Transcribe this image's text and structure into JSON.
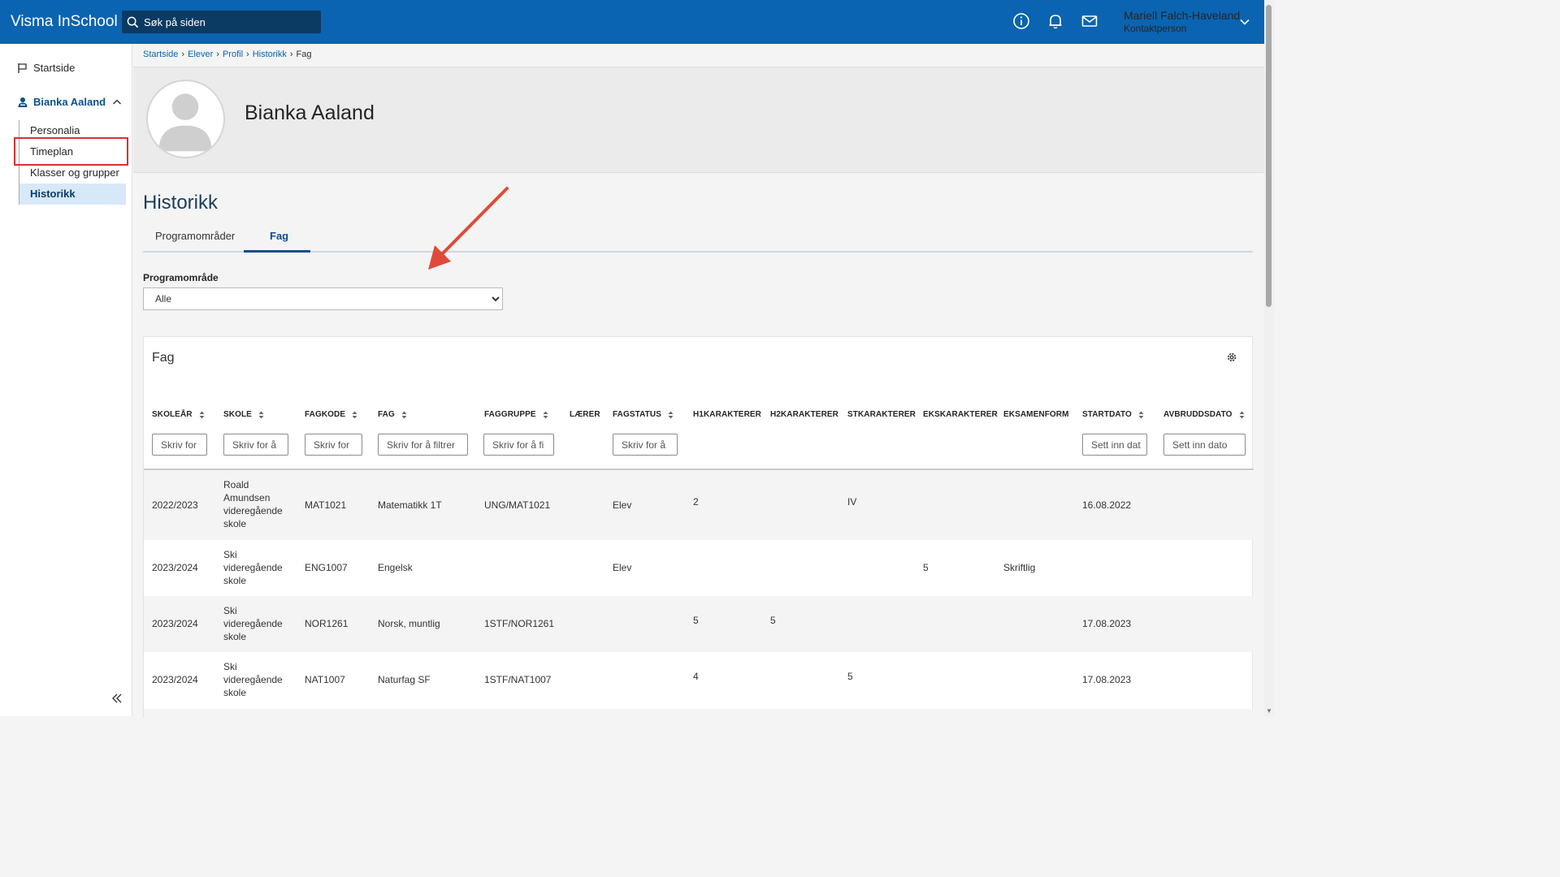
{
  "app": {
    "title": "Visma InSchool"
  },
  "search": {
    "placeholder": "Søk på siden"
  },
  "header": {
    "icons": [
      "info-icon",
      "bell-icon",
      "mail-icon"
    ],
    "user_name": "Mariell Falch-Haveland",
    "user_role": "Kontaktperson"
  },
  "sidebar": {
    "start": "Startside",
    "student": "Bianka Aaland",
    "items": [
      "Personalia",
      "Timeplan",
      "Klasser og grupper",
      "Historikk"
    ]
  },
  "breadcrumb": [
    "Startside",
    "Elever",
    "Profil",
    "Historikk",
    "Fag"
  ],
  "profile": {
    "name": "Bianka Aaland"
  },
  "page": {
    "title": "Historikk",
    "tabs": [
      "Programområder",
      "Fag"
    ],
    "program_label": "Programområde",
    "program_value": "Alle"
  },
  "table": {
    "title": "Fag",
    "headers": [
      "SKOLEÅR",
      "SKOLE",
      "FAGKODE",
      "FAG",
      "FAGGRUPPE",
      "LÆRER",
      "FAGSTATUS",
      "H1KARAKTERER",
      "H2KARAKTERER",
      "STKARAKTERER",
      "EKSKARAKTERER",
      "EKSAMENFORM",
      "STARTDATO",
      "AVBRUDDSDATO"
    ],
    "filters": {
      "skoleaar": "Skriv for",
      "skole": "Skriv for å",
      "fagkode": "Skriv for",
      "fag": "Skriv for å filtrer",
      "faggruppe": "Skriv for å fi",
      "fagstatus": "Skriv for å",
      "startdato": "Sett inn dat",
      "avbruddsdato": "Sett inn dato"
    },
    "rows": [
      {
        "skoleaar": "2022/2023",
        "skole": "Roald Amundsen videregående skole",
        "fagkode": "MAT1021",
        "fag": "Matematikk 1T",
        "faggruppe": "UNG/MAT1021",
        "laerer": "",
        "fagstatus": "Elev",
        "h1": "2",
        "h2": "",
        "st": "IV",
        "eks": "",
        "eksamenform": "",
        "startdato": "16.08.2022",
        "avbruddsdato": ""
      },
      {
        "skoleaar": "2023/2024",
        "skole": "Ski videregående skole",
        "fagkode": "ENG1007",
        "fag": "Engelsk",
        "faggruppe": "",
        "laerer": "",
        "fagstatus": "Elev",
        "h1": "",
        "h2": "",
        "st": "",
        "eks": "5",
        "eksamenform": "Skriftlig",
        "startdato": "",
        "avbruddsdato": ""
      },
      {
        "skoleaar": "2023/2024",
        "skole": "Ski videregående skole",
        "fagkode": "NOR1261",
        "fag": "Norsk, muntlig",
        "faggruppe": "1STF/NOR1261",
        "laerer": "",
        "fagstatus": "",
        "h1": "5",
        "h2": "5",
        "st": "",
        "eks": "",
        "eksamenform": "",
        "startdato": "17.08.2023",
        "avbruddsdato": ""
      },
      {
        "skoleaar": "2023/2024",
        "skole": "Ski videregående skole",
        "fagkode": "NAT1007",
        "fag": "Naturfag SF",
        "faggruppe": "1STF/NAT1007",
        "laerer": "",
        "fagstatus": "",
        "h1": "4",
        "h2": "",
        "st": "5",
        "eks": "",
        "eksamenform": "",
        "startdato": "17.08.2023",
        "avbruddsdato": ""
      }
    ]
  },
  "colors": {
    "topbar": "#0a64b1",
    "accent": "#0b4f8c",
    "highlight": "#d9312f"
  }
}
